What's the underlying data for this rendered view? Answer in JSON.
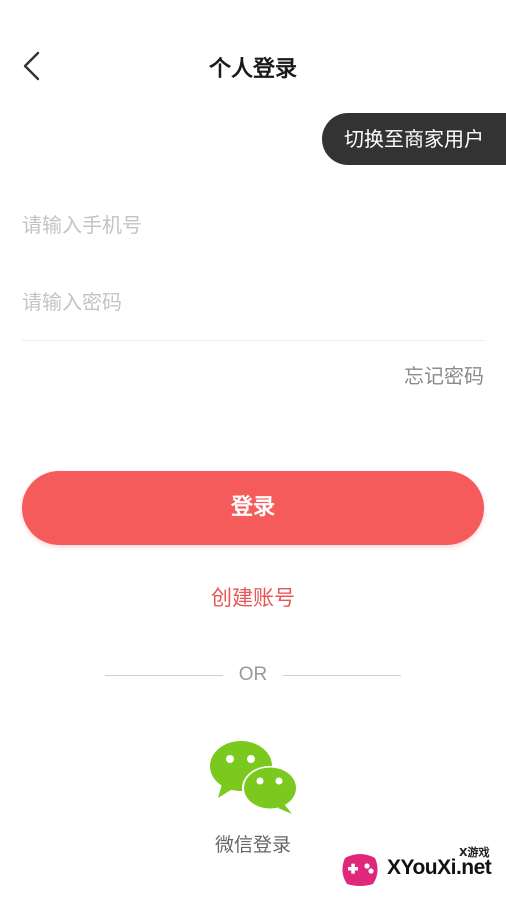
{
  "header": {
    "title": "个人登录",
    "switch_label": "切换至商家用户"
  },
  "form": {
    "phone_placeholder": "请输入手机号",
    "password_placeholder": "请输入密码",
    "forgot_label": "忘记密码",
    "login_label": "登录",
    "create_account_label": "创建账号"
  },
  "alt_login": {
    "or_label": "OR",
    "wechat_label": "微信登录"
  },
  "watermark": {
    "small_text": "X游戏",
    "brand_text": "XYouXi.net"
  },
  "colors": {
    "accent": "#f65b5b",
    "link": "#e95656",
    "switch_bg": "#333333",
    "wechat_green": "#7bc81f"
  },
  "icons": {
    "back": "chevron-left-icon",
    "wechat": "wechat-icon"
  }
}
